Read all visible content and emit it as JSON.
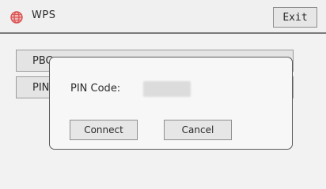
{
  "header": {
    "title": "WPS",
    "exit_label": "Exit",
    "icon": "globe-icon",
    "icon_color": "#e05a5a"
  },
  "methods": {
    "pbc_label": "PBC",
    "pin_label": "PIN"
  },
  "dialog": {
    "pin_code_label": "PIN Code:",
    "pin_code_value": "",
    "connect_label": "Connect",
    "cancel_label": "Cancel"
  }
}
